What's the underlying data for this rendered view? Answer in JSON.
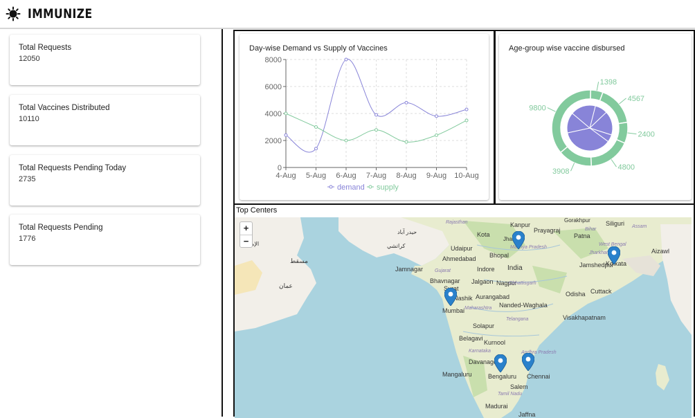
{
  "app": {
    "title": "IMMUNIZE"
  },
  "stats": [
    {
      "label": "Total Requests",
      "value": "12050"
    },
    {
      "label": "Total Vaccines Distributed",
      "value": "10110"
    },
    {
      "label": "Total Requests Pending Today",
      "value": "2735"
    },
    {
      "label": "Total Requests Pending",
      "value": "1776"
    }
  ],
  "line_chart": {
    "title": "Day-wise Demand vs Supply of Vaccines"
  },
  "pie_chart": {
    "title": "Age-group wise vaccine disbursed"
  },
  "map": {
    "title": "Top Centers",
    "zoom_in": "+",
    "zoom_out": "−",
    "labels": [
      "Rajasthan",
      "Kanpur",
      "Prayagraj",
      "Gorakhpur",
      "Siliguri",
      "Assam",
      "Kota",
      "Jhansi",
      "Madhya Pradesh",
      "Bihar",
      "Patna",
      "West Bengal",
      "Jharkhand",
      "Aizawl",
      "Udaipur",
      "Bhopal",
      "Jamshedpur",
      "Kolkata",
      "Ahmedabad",
      "Jamnagar",
      "Indore",
      "India",
      "Gujarat",
      "Bhavnagar",
      "Jalgaon",
      "Nagpur",
      "Chhattisgarh",
      "Surat",
      "Aurangabad",
      "Nashik",
      "Odisha",
      "Cuttack",
      "Nanded-Waghala",
      "Mumbai",
      "Maharashtra",
      "Telangana",
      "Visakhapatnam",
      "Solapur",
      "Belagavi",
      "Kurnool",
      "Karnataka",
      "Andhra Pradesh",
      "Davanagere",
      "Bengaluru",
      "Chennai",
      "Mangaluru",
      "Salem",
      "Tamil Nadu",
      "Madurai",
      "Jaffna",
      "مسقط",
      "عمان",
      "الإمارات",
      "كراتشي",
      "حيدر آباد"
    ]
  },
  "colors": {
    "demand": "#8884d8",
    "supply": "#82ca9d",
    "pin": "#2a81cb"
  },
  "chart_data": [
    {
      "type": "line",
      "title": "Day-wise Demand vs Supply of Vaccines",
      "categories": [
        "4-Aug",
        "5-Aug",
        "6-Aug",
        "7-Aug",
        "8-Aug",
        "9-Aug",
        "10-Aug"
      ],
      "series": [
        {
          "name": "demand",
          "values": [
            2400,
            1400,
            8000,
            3900,
            4800,
            3800,
            4300
          ]
        },
        {
          "name": "supply",
          "values": [
            4000,
            3000,
            2000,
            2780,
            1890,
            2390,
            3490
          ]
        }
      ],
      "yticks": [
        "0",
        "2000",
        "4000",
        "6000",
        "8000"
      ],
      "ylim": [
        0,
        8000
      ],
      "grid": true,
      "legend": "bottom"
    },
    {
      "type": "pie",
      "title": "Age-group wise vaccine disbursed",
      "inner_values": [
        2400,
        4567,
        1398,
        9800,
        3908,
        4800
      ],
      "outer_slices": [
        {
          "label": "4567",
          "value": 4567
        },
        {
          "label": "2400",
          "value": 2400
        },
        {
          "label": "4800",
          "value": 4800
        },
        {
          "label": "3908",
          "value": 3908
        },
        {
          "label": "9800",
          "value": 9800
        },
        {
          "label": "1398",
          "value": 1398
        }
      ]
    }
  ]
}
